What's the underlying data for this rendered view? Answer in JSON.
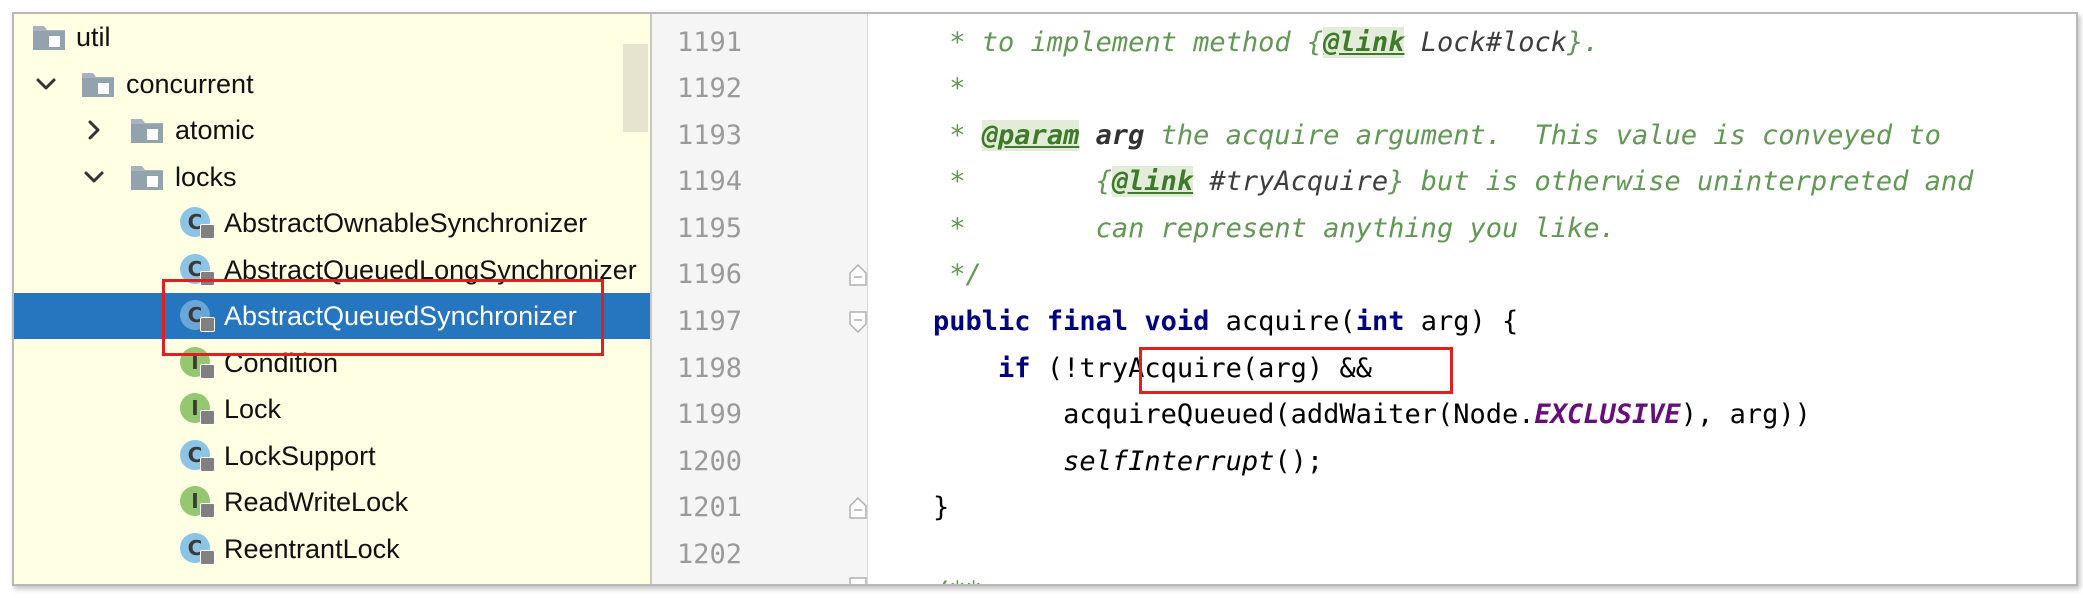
{
  "tree": {
    "items": [
      {
        "label": "util",
        "kind": "folder",
        "chevron": "none",
        "indent": 0
      },
      {
        "label": "concurrent",
        "kind": "folder",
        "chevron": "down",
        "indent": 1
      },
      {
        "label": "atomic",
        "kind": "folder",
        "chevron": "right",
        "indent": 2
      },
      {
        "label": "locks",
        "kind": "folder",
        "chevron": "down",
        "indent": 2
      },
      {
        "label": "AbstractOwnableSynchronizer",
        "kind": "class",
        "badge": "C",
        "indent": 3
      },
      {
        "label": "AbstractQueuedLongSynchronizer",
        "kind": "class",
        "badge": "C",
        "indent": 3
      },
      {
        "label": "AbstractQueuedSynchronizer",
        "kind": "class",
        "badge": "C",
        "indent": 3,
        "selected": true
      },
      {
        "label": "Condition",
        "kind": "interface",
        "badge": "I",
        "indent": 3
      },
      {
        "label": "Lock",
        "kind": "interface",
        "badge": "I",
        "indent": 3
      },
      {
        "label": "LockSupport",
        "kind": "class",
        "badge": "C",
        "indent": 3
      },
      {
        "label": "ReadWriteLock",
        "kind": "interface",
        "badge": "I",
        "indent": 3
      },
      {
        "label": "ReentrantLock",
        "kind": "class",
        "badge": "C",
        "indent": 3
      }
    ]
  },
  "gutter": {
    "lines": [
      "1191",
      "1192",
      "1193",
      "1194",
      "1195",
      "1196",
      "1197",
      "1198",
      "1199",
      "1200",
      "1201",
      "1202"
    ]
  },
  "code": {
    "l1191": {
      "pre": "     * to implement method {",
      "tag": "@link",
      "ref": " Lock#lock",
      "post": "}."
    },
    "l1192": {
      "text": "     *"
    },
    "l1193": {
      "pre": "     * ",
      "tag": "@param",
      "sp": " ",
      "pname": "arg",
      "post": " the acquire argument.  This value is conveyed to"
    },
    "l1194": {
      "pre": "     *        {",
      "tag": "@link",
      "ref": " #tryAcquire",
      "post": "} but is otherwise uninterpreted and"
    },
    "l1195": {
      "text": "     *        can represent anything you like."
    },
    "l1196": {
      "text": "     */"
    },
    "l1197": {
      "indent": "    ",
      "kw1": "public final void",
      "name": " acquire(",
      "kw2": "int",
      "rest": " arg) {"
    },
    "l1198": {
      "indent": "        ",
      "kw": "if",
      "pre": " (!",
      "call": "tryAcquire(arg)",
      "post": " &&"
    },
    "l1199": {
      "indent": "            ",
      "pre": "acquireQueued(addWaiter(Node.",
      "st": "EXCLUSIVE",
      "post": "), arg))"
    },
    "l1200": {
      "indent": "            ",
      "call": "selfInterrupt",
      "post": "();"
    },
    "l1201": {
      "text": "    }"
    },
    "l1202": {
      "text": ""
    },
    "trailing": "    /**"
  },
  "colors": {
    "selection": "#2675bf",
    "highlight_box": "#e02020",
    "tree_bg": "#ffffe4",
    "comment": "#629755",
    "keyword": "#000080",
    "static_field": "#660e7a"
  }
}
